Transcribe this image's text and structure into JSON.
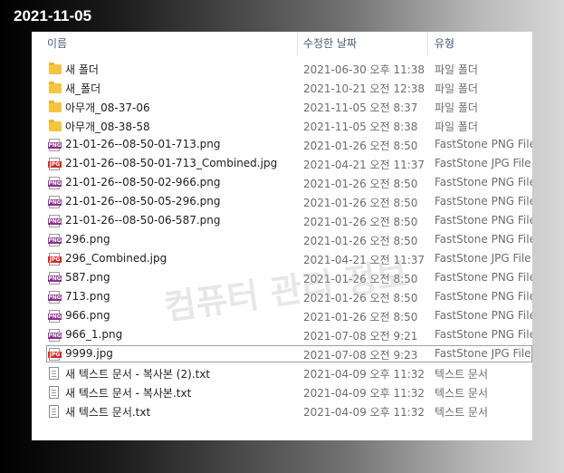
{
  "top_label": "2021-11-05",
  "columns": {
    "name": "이름",
    "date": "수정한 날짜",
    "type": "유형"
  },
  "watermark": "컴퓨터 관리 정보",
  "files": [
    {
      "name": "새 폴더",
      "date": "2021-06-30 오후 11:38",
      "type": "파일 폴더",
      "icon": "folder-icon"
    },
    {
      "name": "새_폴더",
      "date": "2021-10-21 오전 12:38",
      "type": "파일 폴더",
      "icon": "folder-icon"
    },
    {
      "name": "아무개_08-37-06",
      "date": "2021-11-05 오전 8:37",
      "type": "파일 폴더",
      "icon": "folder-icon"
    },
    {
      "name": "아무개_08-38-58",
      "date": "2021-11-05 오전 8:38",
      "type": "파일 폴더",
      "icon": "folder-icon"
    },
    {
      "name": "21-01-26--08-50-01-713.png",
      "date": "2021-01-26 오전 8:50",
      "type": "FastStone PNG File",
      "icon": "png-file-icon"
    },
    {
      "name": "21-01-26--08-50-01-713_Combined.jpg",
      "date": "2021-04-21 오전 11:37",
      "type": "FastStone JPG File",
      "icon": "jpg-file-icon"
    },
    {
      "name": "21-01-26--08-50-02-966.png",
      "date": "2021-01-26 오전 8:50",
      "type": "FastStone PNG File",
      "icon": "png-file-icon"
    },
    {
      "name": "21-01-26--08-50-05-296.png",
      "date": "2021-01-26 오전 8:50",
      "type": "FastStone PNG File",
      "icon": "png-file-icon"
    },
    {
      "name": "21-01-26--08-50-06-587.png",
      "date": "2021-01-26 오전 8:50",
      "type": "FastStone PNG File",
      "icon": "png-file-icon"
    },
    {
      "name": "296.png",
      "date": "2021-01-26 오전 8:50",
      "type": "FastStone PNG File",
      "icon": "png-file-icon"
    },
    {
      "name": "296_Combined.jpg",
      "date": "2021-04-21 오전 11:37",
      "type": "FastStone JPG File",
      "icon": "jpg-file-icon"
    },
    {
      "name": "587.png",
      "date": "2021-01-26 오전 8:50",
      "type": "FastStone PNG File",
      "icon": "png-file-icon"
    },
    {
      "name": "713.png",
      "date": "2021-01-26 오전 8:50",
      "type": "FastStone PNG File",
      "icon": "png-file-icon"
    },
    {
      "name": "966.png",
      "date": "2021-01-26 오전 8:50",
      "type": "FastStone PNG File",
      "icon": "png-file-icon"
    },
    {
      "name": "966_1.png",
      "date": "2021-07-08 오전 9:21",
      "type": "FastStone PNG File",
      "icon": "png-file-icon"
    },
    {
      "name": "9999.jpg",
      "date": "2021-07-08 오전 9:23",
      "type": "FastStone JPG File",
      "icon": "jpg-file-icon",
      "selected": true
    },
    {
      "name": "새 텍스트 문서 - 복사본 (2).txt",
      "date": "2021-04-09 오후 11:32",
      "type": "텍스트 문서",
      "icon": "text-file-icon"
    },
    {
      "name": "새 텍스트 문서 - 복사본.txt",
      "date": "2021-04-09 오후 11:32",
      "type": "텍스트 문서",
      "icon": "text-file-icon"
    },
    {
      "name": "새 텍스트 문서.txt",
      "date": "2021-04-09 오후 11:32",
      "type": "텍스트 문서",
      "icon": "text-file-icon"
    }
  ]
}
